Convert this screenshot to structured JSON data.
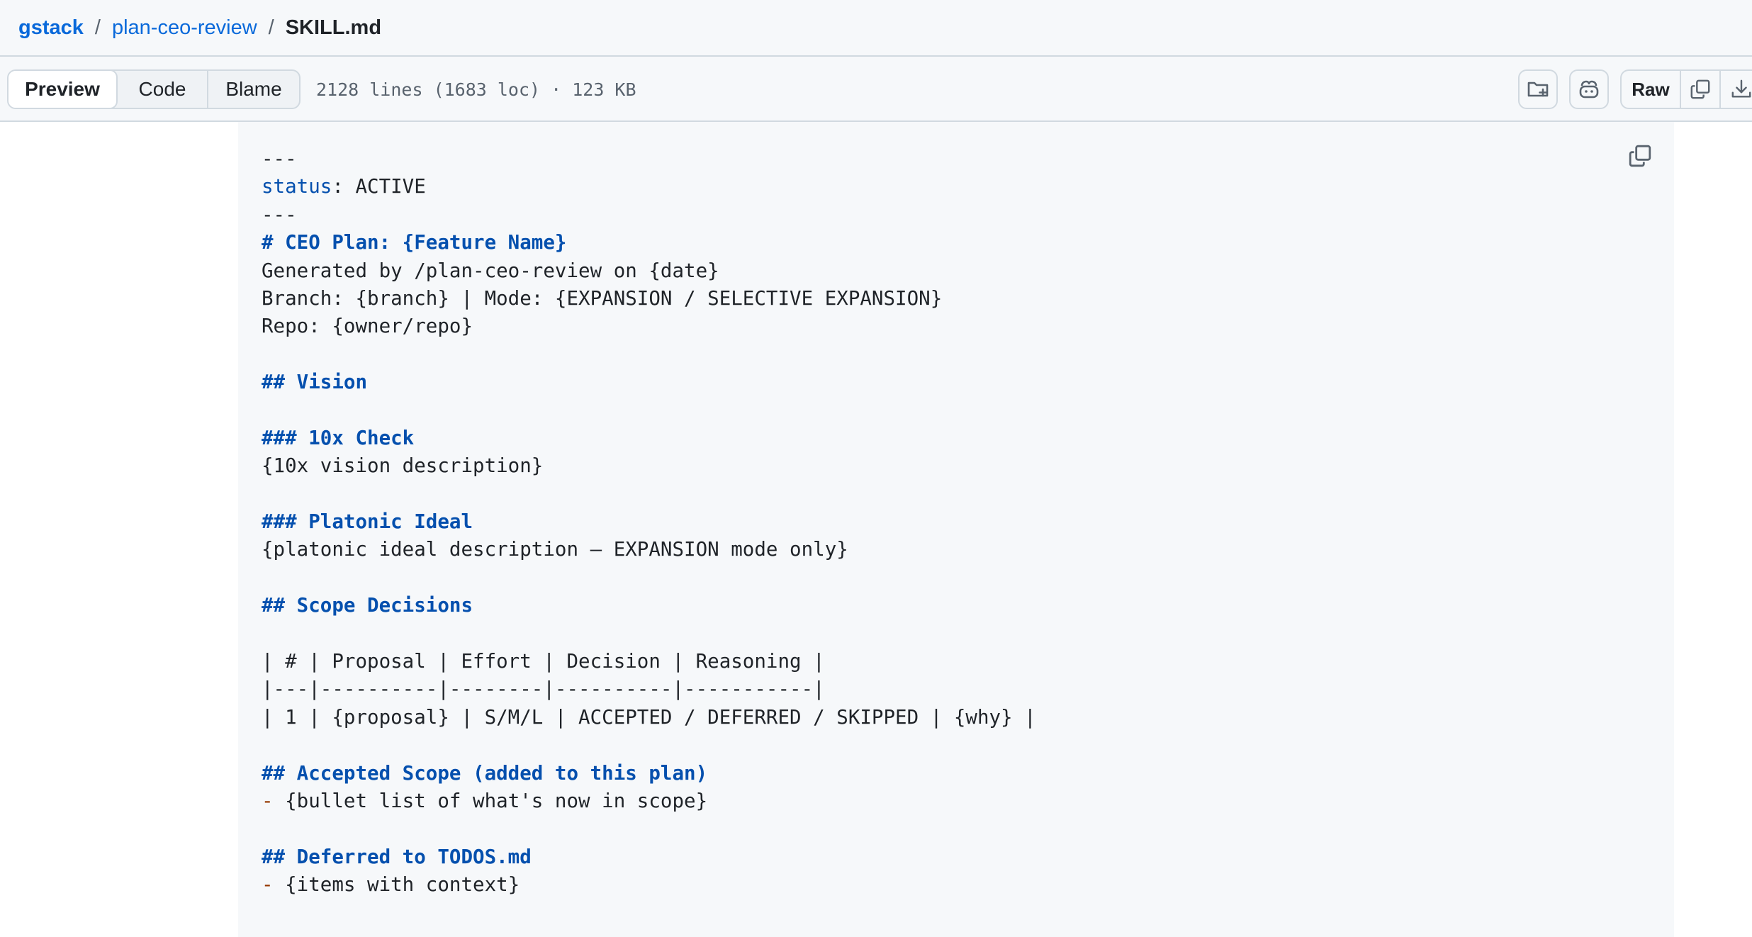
{
  "breadcrumb": {
    "repo": "gstack",
    "folder": "plan-ceo-review",
    "file": "SKILL.md",
    "separator": "/"
  },
  "toolbar": {
    "tabs": [
      "Preview",
      "Code",
      "Blame"
    ],
    "active_tab": "Preview",
    "file_meta": "2128 lines (1683 loc) · 123 KB",
    "raw_label": "Raw",
    "icons": {
      "new_directory": "folder-plus-icon",
      "copilot": "copilot-icon",
      "copy_raw": "copy-icon",
      "download": "download-icon",
      "code_copy": "copy-icon"
    }
  },
  "colors": {
    "link": "#0969da",
    "heading": "#0550ae",
    "bullet": "#953800",
    "panel_bg": "#f6f8fa",
    "border": "#d1d9e0"
  },
  "content": {
    "lines": [
      {
        "text": "---"
      },
      {
        "key": "status",
        "text": ": ACTIVE"
      },
      {
        "text": "---"
      },
      {
        "text": "# CEO Plan: {Feature Name}",
        "heading": true
      },
      {
        "text": "Generated by /plan-ceo-review on {date}"
      },
      {
        "text": "Branch: {branch} | Mode: {EXPANSION / SELECTIVE EXPANSION}"
      },
      {
        "text": "Repo: {owner/repo}"
      },
      {
        "text": ""
      },
      {
        "text": "## Vision",
        "heading": true
      },
      {
        "text": ""
      },
      {
        "text": "### 10x Check",
        "heading": true
      },
      {
        "text": "{10x vision description}"
      },
      {
        "text": ""
      },
      {
        "text": "### Platonic Ideal",
        "heading": true
      },
      {
        "text": "{platonic ideal description — EXPANSION mode only}"
      },
      {
        "text": ""
      },
      {
        "text": "## Scope Decisions",
        "heading": true
      },
      {
        "text": ""
      },
      {
        "text": "| # | Proposal | Effort | Decision | Reasoning |"
      },
      {
        "text": "|---|----------|--------|----------|-----------|"
      },
      {
        "text": "| 1 | {proposal} | S/M/L | ACCEPTED / DEFERRED / SKIPPED | {why} |"
      },
      {
        "text": ""
      },
      {
        "text": "## Accepted Scope (added to this plan)",
        "heading": true
      },
      {
        "bullet": "-",
        "text": " {bullet list of what's now in scope}"
      },
      {
        "text": ""
      },
      {
        "text": "## Deferred to TODOS.md",
        "heading": true
      },
      {
        "bullet": "-",
        "text": " {items with context}"
      }
    ]
  }
}
